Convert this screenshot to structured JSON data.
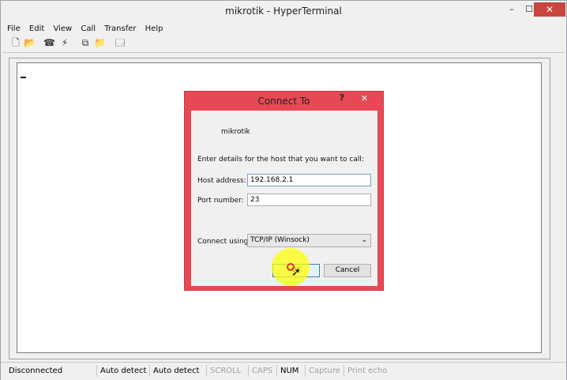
{
  "window": {
    "title": "mikrotik - HyperTerminal",
    "minimize": "–",
    "maximize": "☐",
    "close": "✕"
  },
  "menu": [
    "File",
    "Edit",
    "View",
    "Call",
    "Transfer",
    "Help"
  ],
  "toolbar": [
    {
      "name": "new-connection-icon",
      "glyph": "🗋"
    },
    {
      "name": "open-icon",
      "glyph": "📂"
    },
    {
      "name": "call-icon",
      "glyph": "☎"
    },
    {
      "name": "disconnect-icon",
      "glyph": "⚡"
    },
    {
      "name": "send-file-icon",
      "glyph": "⧉"
    },
    {
      "name": "receive-file-icon",
      "glyph": "📁"
    },
    {
      "name": "properties-icon",
      "glyph": "🗔"
    }
  ],
  "dialog": {
    "title": "Connect To",
    "help": "?",
    "close": "✕",
    "connection_name": "mikrotik",
    "prompt": "Enter details for the host that you want to call:",
    "host_label": "Host address:",
    "host_value": "192.168.2.1",
    "port_label": "Port number:",
    "port_value": "23",
    "connect_label": "Connect using:",
    "connect_value": "TCP/IP (Winsock)",
    "ok": "OK",
    "cancel": "Cancel"
  },
  "status": [
    {
      "text": "Disconnected",
      "enabled": true
    },
    {
      "text": "Auto detect",
      "enabled": true
    },
    {
      "text": "Auto detect",
      "enabled": true
    },
    {
      "text": "SCROLL",
      "enabled": false
    },
    {
      "text": "CAPS",
      "enabled": false
    },
    {
      "text": "NUM",
      "enabled": true
    },
    {
      "text": "Capture",
      "enabled": false
    },
    {
      "text": "Print echo",
      "enabled": false
    }
  ]
}
